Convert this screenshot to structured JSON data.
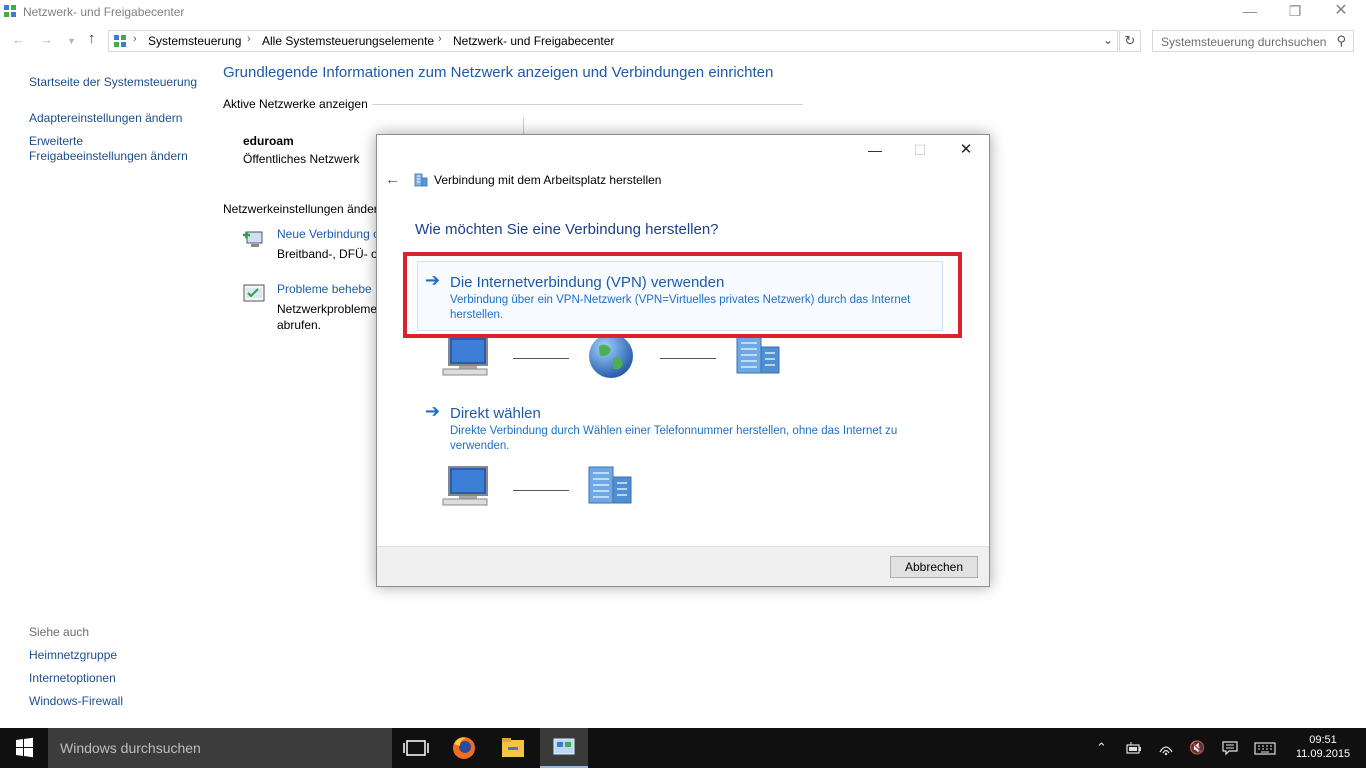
{
  "window": {
    "title": "Netzwerk- und Freigabecenter"
  },
  "address": {
    "crumbs": [
      "Systemsteuerung",
      "Alle Systemsteuerungselemente",
      "Netzwerk- und Freigabecenter"
    ],
    "search_placeholder": "Systemsteuerung durchsuchen"
  },
  "sidebar": {
    "links": [
      "Startseite der Systemsteuerung",
      "Adaptereinstellungen ändern",
      "Erweiterte",
      "Freigabeeinstellungen ändern"
    ],
    "see_also_label": "Siehe auch",
    "see_also": [
      "Heimnetzgruppe",
      "Internetoptionen",
      "Windows-Firewall"
    ]
  },
  "main": {
    "title": "Grundlegende Informationen zum Netzwerk anzeigen und Verbindungen einrichten",
    "active_header": "Aktive Netzwerke anzeigen",
    "network_name": "eduroam",
    "network_type": "Öffentliches Netzwerk",
    "settings_header": "Netzwerkeinstellungen änder",
    "task1_link": "Neue Verbindung o",
    "task1_desc": "Breitband-, DFÜ- o",
    "task2_link": "Probleme behebe",
    "task2_desc1": "Netzwerkprobleme",
    "task2_desc2": "abrufen."
  },
  "dialog": {
    "title": "Verbindung mit dem Arbeitsplatz herstellen",
    "question": "Wie möchten Sie eine Verbindung herstellen?",
    "option1": {
      "title": "Die Internetverbindung (VPN) verwenden",
      "desc1": "Verbindung über ein VPN-Netzwerk (VPN=Virtuelles privates Netzwerk) durch das Internet",
      "desc2": "herstellen."
    },
    "option2": {
      "title": "Direkt wählen",
      "desc1": "Direkte Verbindung durch Wählen einer Telefonnummer herstellen, ohne das Internet zu",
      "desc2": "verwenden."
    },
    "cancel_label": "Abbrechen"
  },
  "taskbar": {
    "search_placeholder": "Windows durchsuchen",
    "time": "09:51",
    "date": "11.09.2015"
  },
  "colors": {
    "link": "#1e5aa8",
    "highlight_frame": "#d9232d",
    "taskbar": "#101010"
  }
}
